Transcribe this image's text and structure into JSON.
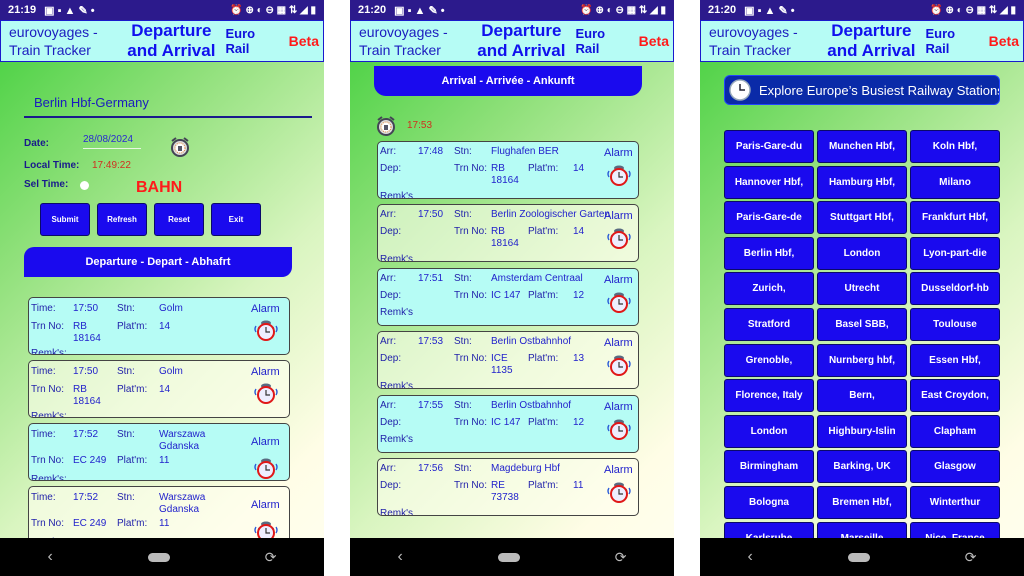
{
  "common": {
    "app_name_line1": "eurovoyages -",
    "app_name_line2": "Train Tracker",
    "title_line1": "Departure",
    "title_line2": "and Arrival",
    "euro_rail": "Euro Rail",
    "beta": "Beta",
    "status_icons": [
      "radio-icon",
      "image-icon",
      "warning-icon",
      "wrench-icon",
      "dot-icon",
      "alarm-icon",
      "data-saver-icon",
      "eye-icon",
      "dnd-icon",
      "volte-icon",
      "4g-icon",
      "signal-icon",
      "battery-icon"
    ]
  },
  "screens": [
    {
      "status_time": "21:19",
      "station": "Berlin Hbf-Germany",
      "date_label": "Date:",
      "date_value": "28/08/2024",
      "local_time_label": "Local Time:",
      "local_time_value": "17:49:22",
      "sel_time_label": "Sel Time:",
      "operator": "BAHN",
      "buttons": [
        "Submit",
        "Refresh",
        "Reset",
        "Exit"
      ],
      "section_title": "Departure - Depart - Abhafrt",
      "labels": {
        "time": "Time:",
        "stn": "Stn:",
        "trn": "Trn No:",
        "plat": "Plat'm:",
        "remk": "Remk's:",
        "alarm": "Alarm"
      },
      "departures": [
        {
          "time": "17:50",
          "station": "Golm",
          "train_line1": "RB",
          "train_line2": "18164",
          "platform": "14"
        },
        {
          "time": "17:50",
          "station": "Golm",
          "train_line1": "RB",
          "train_line2": "18164",
          "platform": "14"
        },
        {
          "time": "17:52",
          "station": "Warszawa",
          "station_line2": "Gdanska",
          "train_line1": "EC 249",
          "train_line2": "",
          "platform": "11"
        },
        {
          "time": "17:52",
          "station": "Warszawa",
          "station_line2": "Gdanska",
          "train_line1": "EC 249",
          "train_line2": "",
          "platform": "11"
        }
      ]
    },
    {
      "status_time": "21:20",
      "section_title": "Arrival - Arrivée - Ankunft",
      "selected_time": "17:53",
      "labels": {
        "arr": "Arr:",
        "dep": "Dep:",
        "stn": "Stn:",
        "trn": "Trn No:",
        "plat": "Plat'm:",
        "remk": "Remk's",
        "alarm": "Alarm"
      },
      "arrivals": [
        {
          "arr": "17:48",
          "station": "Flughafen BER",
          "train_line1": "RB",
          "train_line2": "18164",
          "platform": "14"
        },
        {
          "arr": "17:50",
          "station": "Berlin Zoologischer Garten",
          "train_line1": "RB",
          "train_line2": "18164",
          "platform": "14"
        },
        {
          "arr": "17:51",
          "station": "Amsterdam Centraal",
          "train_line1": "IC 147",
          "train_line2": "",
          "platform": "12"
        },
        {
          "arr": "17:53",
          "station": "Berlin Ostbahnhof",
          "train_line1": "ICE",
          "train_line2": "1135",
          "platform": "13"
        },
        {
          "arr": "17:55",
          "station": "Berlin Ostbahnhof",
          "train_line1": "IC 147",
          "train_line2": "",
          "platform": "12"
        },
        {
          "arr": "17:56",
          "station": "Magdeburg Hbf",
          "train_line1": "RE",
          "train_line2": "73738",
          "platform": "11"
        }
      ]
    },
    {
      "status_time": "21:20",
      "explore_label": "Explore Europe’s Busiest Railway Stations",
      "stations": [
        "Paris-Gare-du",
        "Munchen Hbf,",
        "Koln Hbf,",
        "Hannover Hbf,",
        "Hamburg Hbf,",
        "Milano",
        "Paris-Gare-de",
        "Stuttgart Hbf,",
        "Frankfurt Hbf,",
        "Berlin Hbf,",
        "London",
        "Lyon-part-die",
        "Zurich,",
        "Utrecht",
        "Dusseldorf-hb",
        "Stratford",
        "Basel SBB,",
        "Toulouse",
        "Grenoble,",
        "Nurnberg hbf,",
        "Essen Hbf,",
        "Florence, Italy",
        "Bern,",
        "East Croydon,",
        "London",
        "Highbury-Islin",
        "Clapham",
        "Birmingham",
        "Barking, UK",
        "Glasgow",
        "Bologna",
        "Bremen Hbf,",
        "Winterthur",
        "Karlsruhe",
        "Marseille",
        "Nice, France"
      ]
    }
  ],
  "colors": {
    "accent": "#1a0aee",
    "header_bg": "#b6fcf5",
    "status_bar": "#2c1a8c",
    "beta": "#ff1a1a"
  }
}
